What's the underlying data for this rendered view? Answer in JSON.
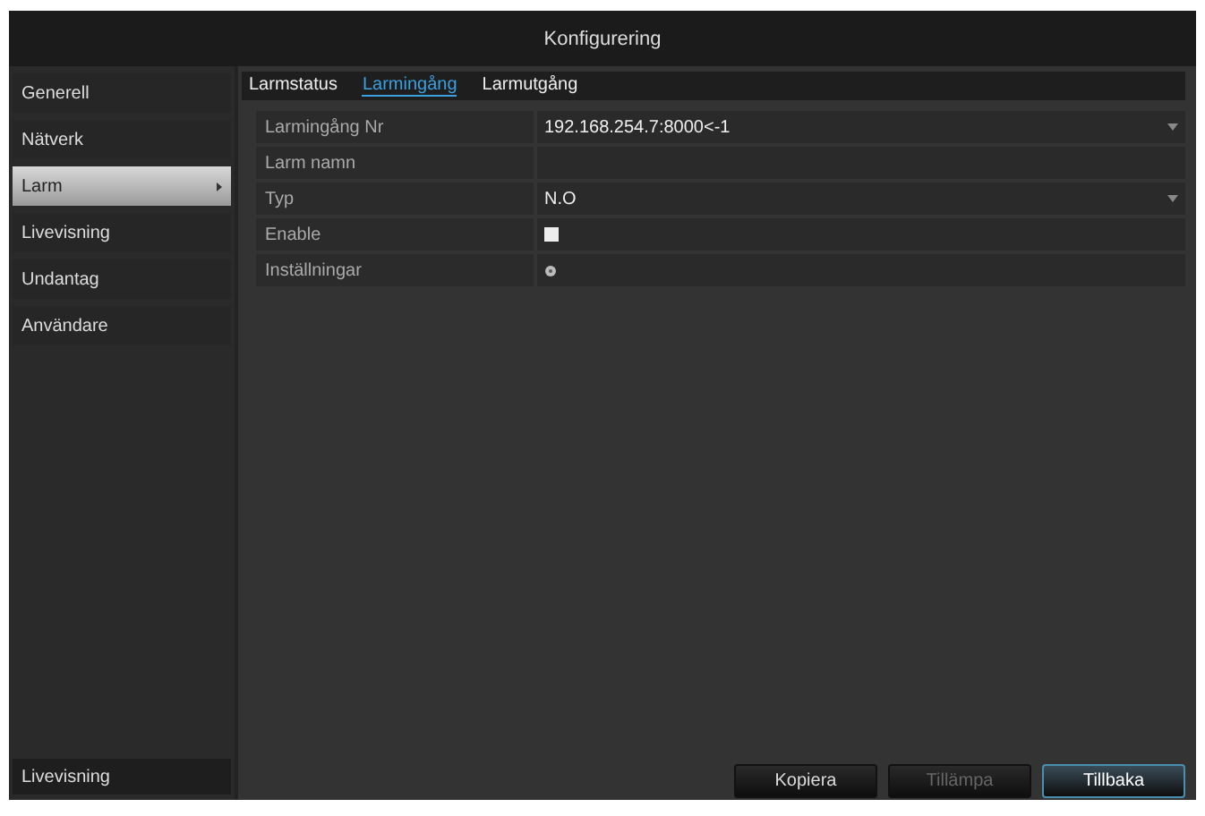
{
  "window": {
    "title": "Konfigurering"
  },
  "sidebar": {
    "items": [
      {
        "label": "Generell",
        "selected": false
      },
      {
        "label": "Nätverk",
        "selected": false
      },
      {
        "label": "Larm",
        "selected": true
      },
      {
        "label": "Livevisning",
        "selected": false
      },
      {
        "label": "Undantag",
        "selected": false
      },
      {
        "label": "Användare",
        "selected": false
      }
    ],
    "footer": "Livevisning"
  },
  "tabs": [
    {
      "label": "Larmstatus",
      "selected": false
    },
    {
      "label": "Larmingång",
      "selected": true
    },
    {
      "label": "Larmutgång",
      "selected": false
    }
  ],
  "form": [
    {
      "label": "Larmingång Nr",
      "kind": "dropdown",
      "value": "192.168.254.7:8000<-1"
    },
    {
      "label": "Larm namn",
      "kind": "text"
    },
    {
      "label": "Typ",
      "kind": "dropdown",
      "value": "N.O"
    },
    {
      "label": "Enable",
      "kind": "checkbox",
      "checked": false
    },
    {
      "label": "Inställningar",
      "kind": "settings"
    }
  ],
  "buttons": [
    {
      "label": "Kopiera",
      "disabled": false,
      "selected": false
    },
    {
      "label": "Tillämpa",
      "disabled": true,
      "selected": false
    },
    {
      "label": "Tillbaka",
      "disabled": false,
      "selected": true
    }
  ]
}
